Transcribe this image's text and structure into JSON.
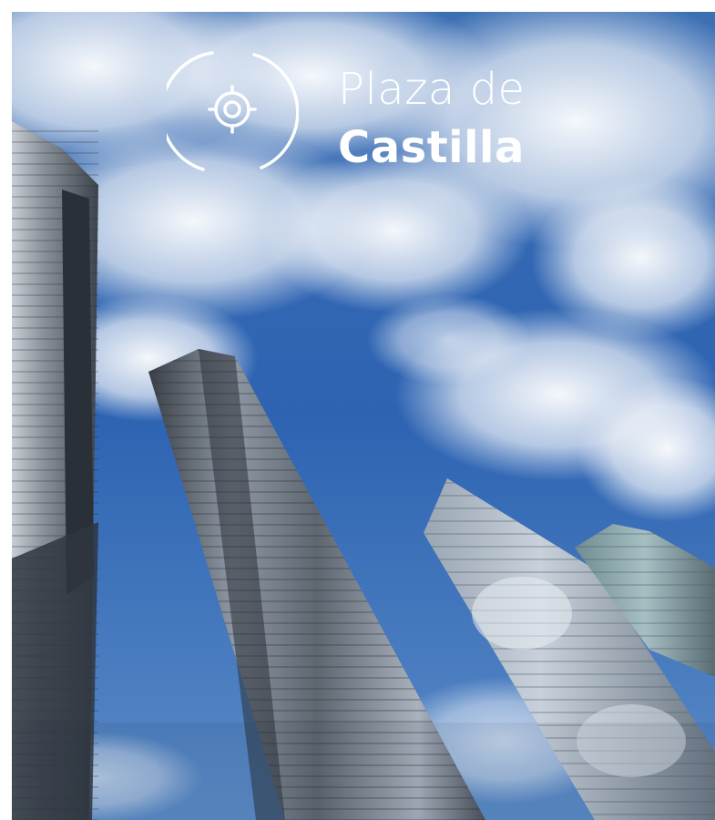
{
  "photo": {
    "subject": "skyscraper-towers-photo"
  },
  "title": {
    "line1": "Plaza de",
    "line2": "Castilla"
  },
  "icon": {
    "name": "location-target-icon",
    "color": "#ffffff"
  },
  "colors": {
    "sky": "#2f66b4",
    "cloud": "#e8eef6",
    "glass": "#7a8797",
    "text": "#ffffff"
  }
}
